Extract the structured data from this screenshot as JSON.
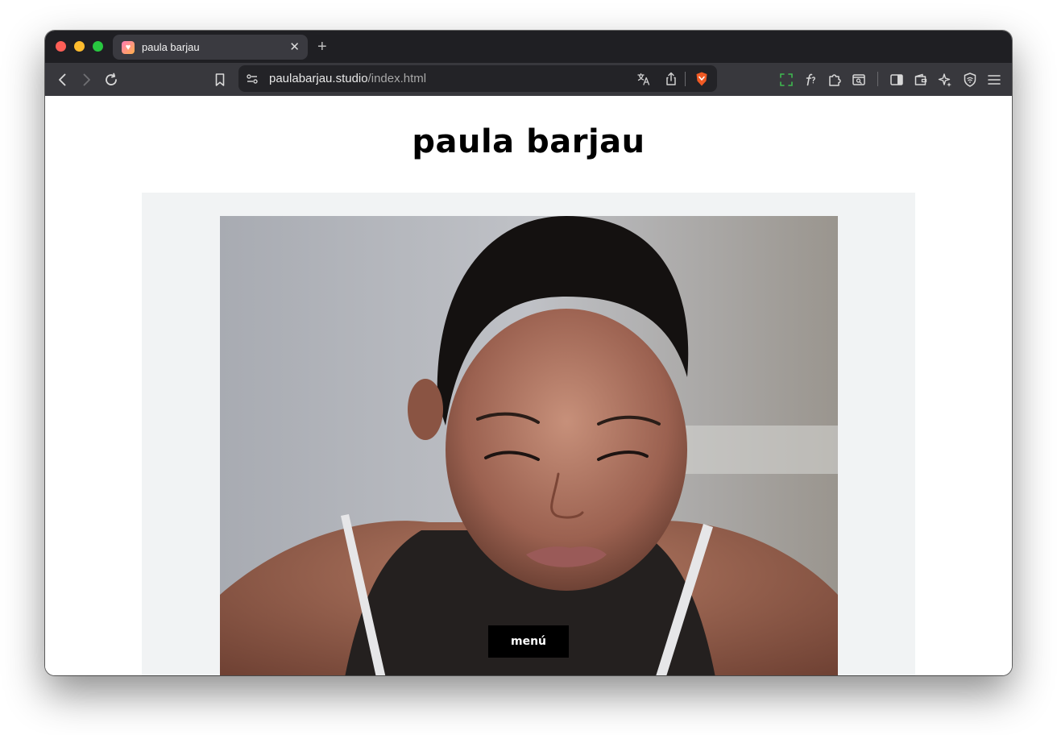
{
  "browser": {
    "tab_title": "paula barjau",
    "url_domain": "paulabarjau.studio",
    "url_path": "/index.html"
  },
  "page": {
    "site_title": "paula barjau",
    "menu_label": "menú"
  },
  "colors": {
    "tabstrip": "#1f1f23",
    "toolbar": "#38383d",
    "urlbar": "#232327",
    "hero_background": "#f1f3f4",
    "menu_button": "#000000"
  },
  "icons": [
    "back-arrow-icon",
    "forward-arrow-icon",
    "reload-icon",
    "bookmark-icon",
    "site-settings-icon",
    "translate-icon",
    "share-icon",
    "brave-shield-icon",
    "screenshot-icon",
    "font-icon",
    "extensions-icon",
    "reader-mode-icon",
    "sidebar-icon",
    "wallet-icon",
    "leo-ai-icon",
    "vpn-icon",
    "menu-icon"
  ]
}
